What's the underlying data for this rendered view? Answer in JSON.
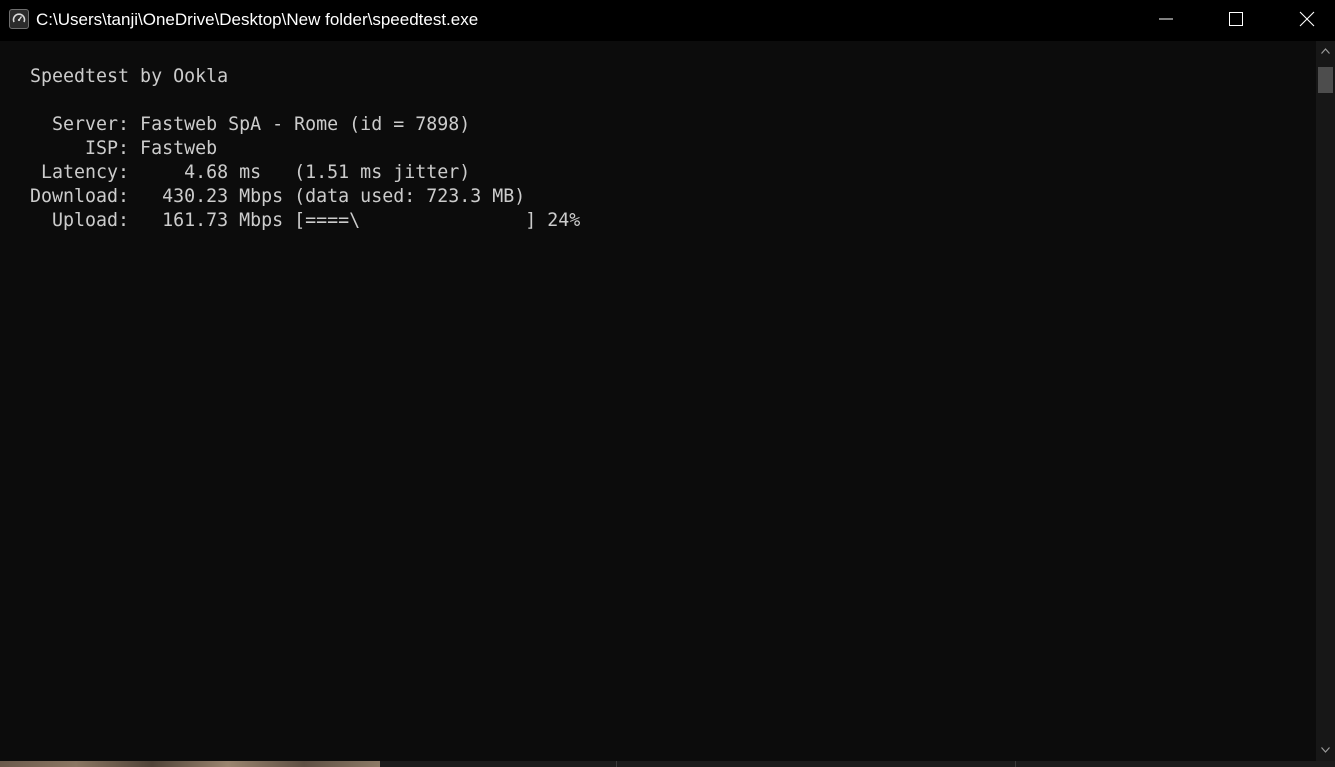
{
  "window": {
    "title": "C:\\Users\\tanji\\OneDrive\\Desktop\\New folder\\speedtest.exe",
    "icon": "speedtest-gauge-icon",
    "caption_buttons": [
      "minimize-icon",
      "maximize-icon",
      "close-icon"
    ]
  },
  "console": {
    "lines": [
      "Speedtest by Ookla",
      "  Server: Fastweb SpA - Rome (id = 7898)",
      "     ISP: Fastweb",
      " Latency:     4.68 ms   (1.51 ms jitter)",
      "Download:   430.23 Mbps (data used: 723.3 MB)",
      "  Upload:   161.73 Mbps [====\\               ] 24%"
    ],
    "text_color": "#cccccc",
    "background": "#0c0c0c"
  },
  "speedtest": {
    "upload_progress_percent": 24
  },
  "scrollbar": {
    "icons": [
      "scroll-up-arrow-icon",
      "scroll-down-arrow-icon"
    ]
  }
}
